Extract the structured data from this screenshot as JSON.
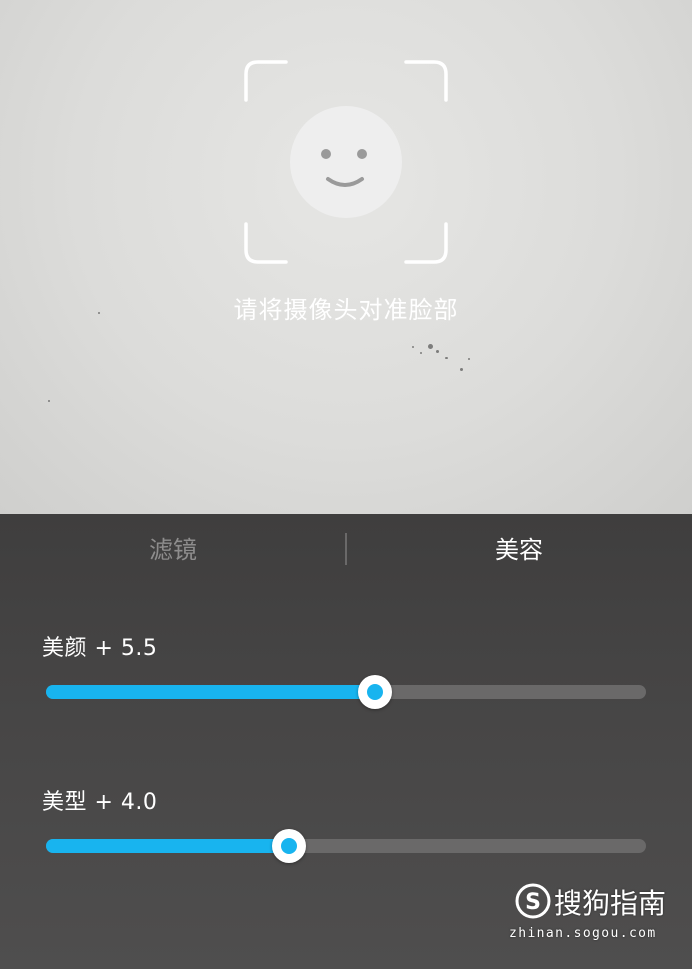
{
  "viewfinder": {
    "hint": "请将摄像头对准脸部",
    "face_icon": "smiley-face-icon",
    "frame_icon": "face-frame-corners-icon"
  },
  "tabs": [
    {
      "label": "滤镜",
      "active": false
    },
    {
      "label": "美容",
      "active": true
    }
  ],
  "sliders": [
    {
      "label": "美颜 + 5.5",
      "value": 5.5,
      "max": 10
    },
    {
      "label": "美型 + 4.0",
      "value": 4.0,
      "max": 10
    }
  ],
  "watermark": {
    "name": "搜狗指南",
    "url": "zhinan.sogou.com",
    "logo_icon": "sogou-s-logo"
  },
  "colors": {
    "accent": "#18b4ef",
    "panel": "#474646",
    "track": "#6a6969",
    "inactive_tab": "#8e8d8d",
    "active_tab": "#ffffff"
  }
}
